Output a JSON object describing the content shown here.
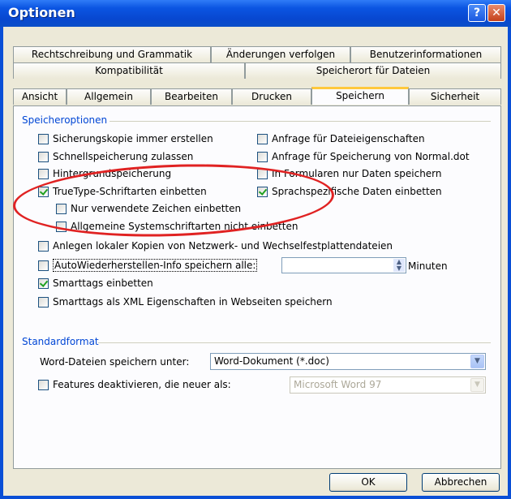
{
  "window": {
    "title": "Optionen",
    "help_glyph": "?",
    "close_glyph": "✕"
  },
  "tabs": {
    "row1": [
      "Rechtschreibung und Grammatik",
      "Änderungen verfolgen",
      "Benutzerinformationen"
    ],
    "row2": [
      "Kompatibilität",
      "Speicherort für Dateien"
    ],
    "row3": [
      "Ansicht",
      "Allgemein",
      "Bearbeiten",
      "Drucken",
      "Speichern",
      "Sicherheit"
    ],
    "active": "Speichern"
  },
  "speicheroptionen": {
    "title": "Speicheroptionen",
    "left": [
      {
        "label": "Sicherungskopie immer erstellen",
        "checked": false
      },
      {
        "label": "Schnellspeicherung zulassen",
        "checked": false
      },
      {
        "label": "Hintergrundspeicherung",
        "checked": false
      },
      {
        "label": "TrueType-Schriftarten einbetten",
        "checked": true
      },
      {
        "label": "Nur verwendete Zeichen einbetten",
        "checked": false
      },
      {
        "label": "Allgemeine Systemschriftarten nicht einbetten",
        "checked": false
      }
    ],
    "right": [
      {
        "label": "Anfrage für Dateieigenschaften",
        "checked": false
      },
      {
        "label": "Anfrage für Speicherung von Normal.dot",
        "checked": false
      },
      {
        "label": "In Formularen nur Daten speichern",
        "checked": false
      },
      {
        "label": "Sprachspezifische Daten einbetten",
        "checked": true
      }
    ],
    "lokale_kopien": {
      "label": "Anlegen lokaler Kopien von Netzwerk- und Wechselfestplattendateien",
      "checked": false
    },
    "autowiederherstellen": {
      "label": "AutoWiederherstellen-Info speichern alle:",
      "checked": false,
      "value": "",
      "unit": "Minuten"
    },
    "smarttags": {
      "label": "Smarttags einbetten",
      "checked": true
    },
    "smarttags_xml": {
      "label": "Smarttags als XML Eigenschaften in Webseiten speichern",
      "checked": false
    }
  },
  "standardformat": {
    "title": "Standardformat",
    "save_as_label": "Word-Dateien speichern unter:",
    "save_as_value": "Word-Dokument (*.doc)",
    "disable_features": {
      "label": "Features deaktivieren, die neuer als:",
      "checked": false
    },
    "disable_features_value": "Microsoft Word 97"
  },
  "buttons": {
    "ok": "OK",
    "cancel": "Abbrechen"
  },
  "annotation_color": "#e02222"
}
